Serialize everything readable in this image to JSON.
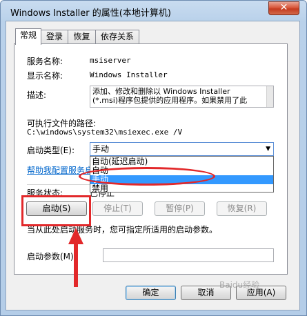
{
  "window": {
    "title": "Windows Installer 的属性(本地计算机)",
    "close_glyph": "✕"
  },
  "tabs": [
    {
      "label": "常规",
      "active": true
    },
    {
      "label": "登录",
      "active": false
    },
    {
      "label": "恢复",
      "active": false
    },
    {
      "label": "依存关系",
      "active": false
    }
  ],
  "general": {
    "service_name_label": "服务名称:",
    "service_name_value": "msiserver",
    "display_name_label": "显示名称:",
    "display_name_value": "Windows Installer",
    "description_label": "描述:",
    "description_lines": [
      "添加、修改和删除以 Windows Installer",
      "(*.msi)程序包提供的应用程序。如果禁用了此"
    ],
    "exe_path_label": "可执行文件的路径:",
    "exe_path_value": "C:\\windows\\system32\\msiexec.exe /V",
    "startup_type_label": "启动类型(E):",
    "startup_type_value": "手动",
    "startup_options": [
      {
        "label": "自动(延迟启动)",
        "selected": false
      },
      {
        "label": "自动",
        "selected": false
      },
      {
        "label": "手动",
        "selected": true
      },
      {
        "label": "禁用",
        "selected": false
      }
    ],
    "help_link": "帮助我配置服务启",
    "service_status_label": "服务状态:",
    "service_status_value": "已停止",
    "buttons": {
      "start": "启动(S)",
      "stop": "停止(T)",
      "pause": "暂停(P)",
      "resume": "恢复(R)"
    },
    "start_hint": "当从此处启动服务时，您可指定所适用的启动参数。",
    "start_params_label": "启动参数(M):",
    "start_params_value": ""
  },
  "footer": {
    "ok": "确定",
    "cancel": "取消",
    "apply": "应用(A)"
  },
  "watermark": "Baidu经验",
  "colors": {
    "annotation": "#e2282a",
    "selection": "#3399ff",
    "link": "#0066cc"
  }
}
